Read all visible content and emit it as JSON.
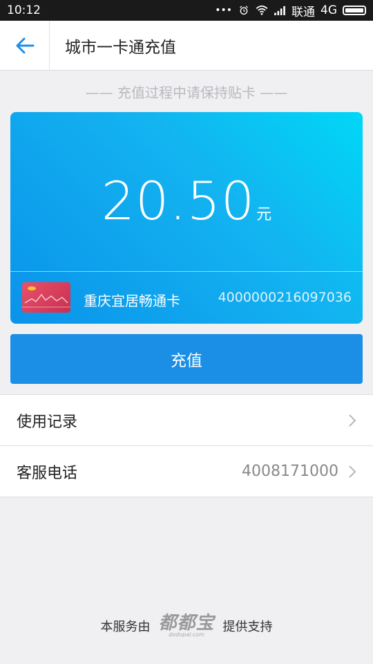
{
  "status_bar": {
    "time": "10:12",
    "dots": "•••",
    "carrier": "联通",
    "network": "4G"
  },
  "header": {
    "title": "城市一卡通充值"
  },
  "hint": "—— 充值过程中请保持贴卡 ——",
  "card": {
    "amount": "20.50",
    "unit": "元",
    "card_name": "重庆宜居畅通卡",
    "card_number": "4000000216097036"
  },
  "recharge_button": "充值",
  "list": [
    {
      "label": "使用记录",
      "value": ""
    },
    {
      "label": "客服电话",
      "value": "4008171000"
    }
  ],
  "footer": {
    "prefix": "本服务由",
    "brand": "都都宝",
    "brand_sub": "dodopal.com",
    "suffix": "提供支持"
  },
  "colors": {
    "accent": "#1b8fe6",
    "card_gradient_start": "#00d7f7",
    "card_gradient_end": "#0a93ea"
  }
}
